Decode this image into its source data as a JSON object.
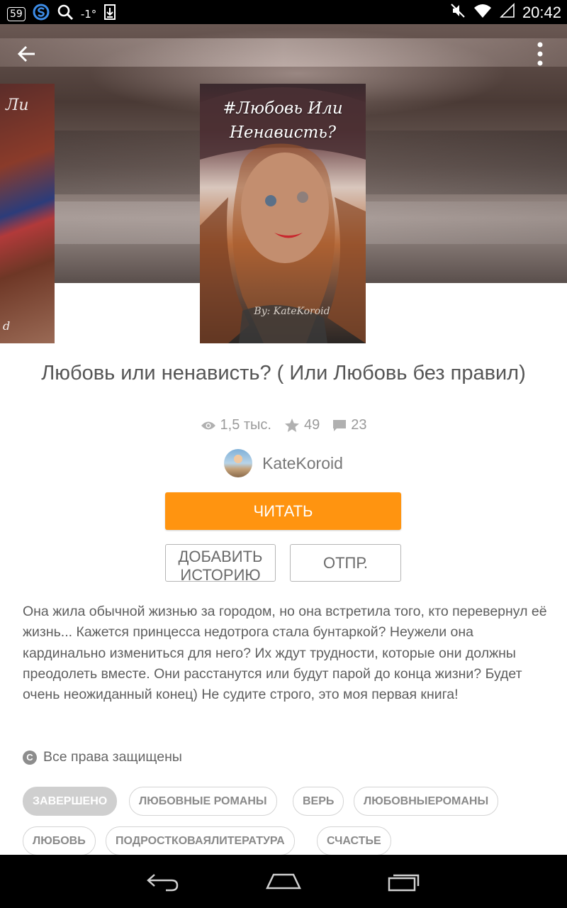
{
  "status_bar": {
    "badge": "59",
    "signal_text": "-1°",
    "time": "20:42",
    "icons": [
      "notification-badge-icon",
      "s-app-icon",
      "search-icon",
      "temperature-text",
      "download-icon",
      "mute-icon",
      "wifi-icon",
      "signal-icon"
    ]
  },
  "header": {
    "back_icon": "arrow-left-icon",
    "menu_icon": "more-vertical-icon"
  },
  "covers": {
    "prev_text_top": "Ли",
    "prev_text_bottom": "d",
    "main_title": "#Любовь Или Ненависть?",
    "main_author": "By: KateKoroid"
  },
  "book": {
    "title": "Любовь или ненависть? ( Или Любовь без правил)",
    "views": "1,5 тыс.",
    "votes": "49",
    "comments": "23",
    "author": "KateKoroid"
  },
  "buttons": {
    "read": "ЧИТАТЬ",
    "add_story": "ДОБАВИТЬ ИСТОРИЮ",
    "send": "ОТПР."
  },
  "description": "Она жила обычной жизнью за городом, но она встретила того, кто перевернул её жизнь... Кажется принцесса недотрога стала бунтаркой? Неужели она кардинально измениться для него? Их ждут трудности, которые они должны преодолеть вместе. Они расстанутся или будут парой до конца жизни? Будет очень неожиданный конец) Не судите строго, это моя первая книга!",
  "copyright": "Все права защищены",
  "tags": [
    "ЗАВЕРШЕНО",
    "ЛЮБОВНЫЕ РОМАНЫ",
    "ВЕРЬ",
    "ЛЮБОВНЫЕРОМАНЫ",
    "ЛЮБОВЬ",
    "ПОДРОСТКОВАЯЛИТЕРАТУРА",
    "СЧАСТЬЕ"
  ],
  "colors": {
    "accent": "#ff9410",
    "text_primary": "#555555",
    "text_muted": "#9a9a9a"
  },
  "navbar": {
    "icons": [
      "nav-back-icon",
      "nav-home-icon",
      "nav-recents-icon"
    ]
  }
}
